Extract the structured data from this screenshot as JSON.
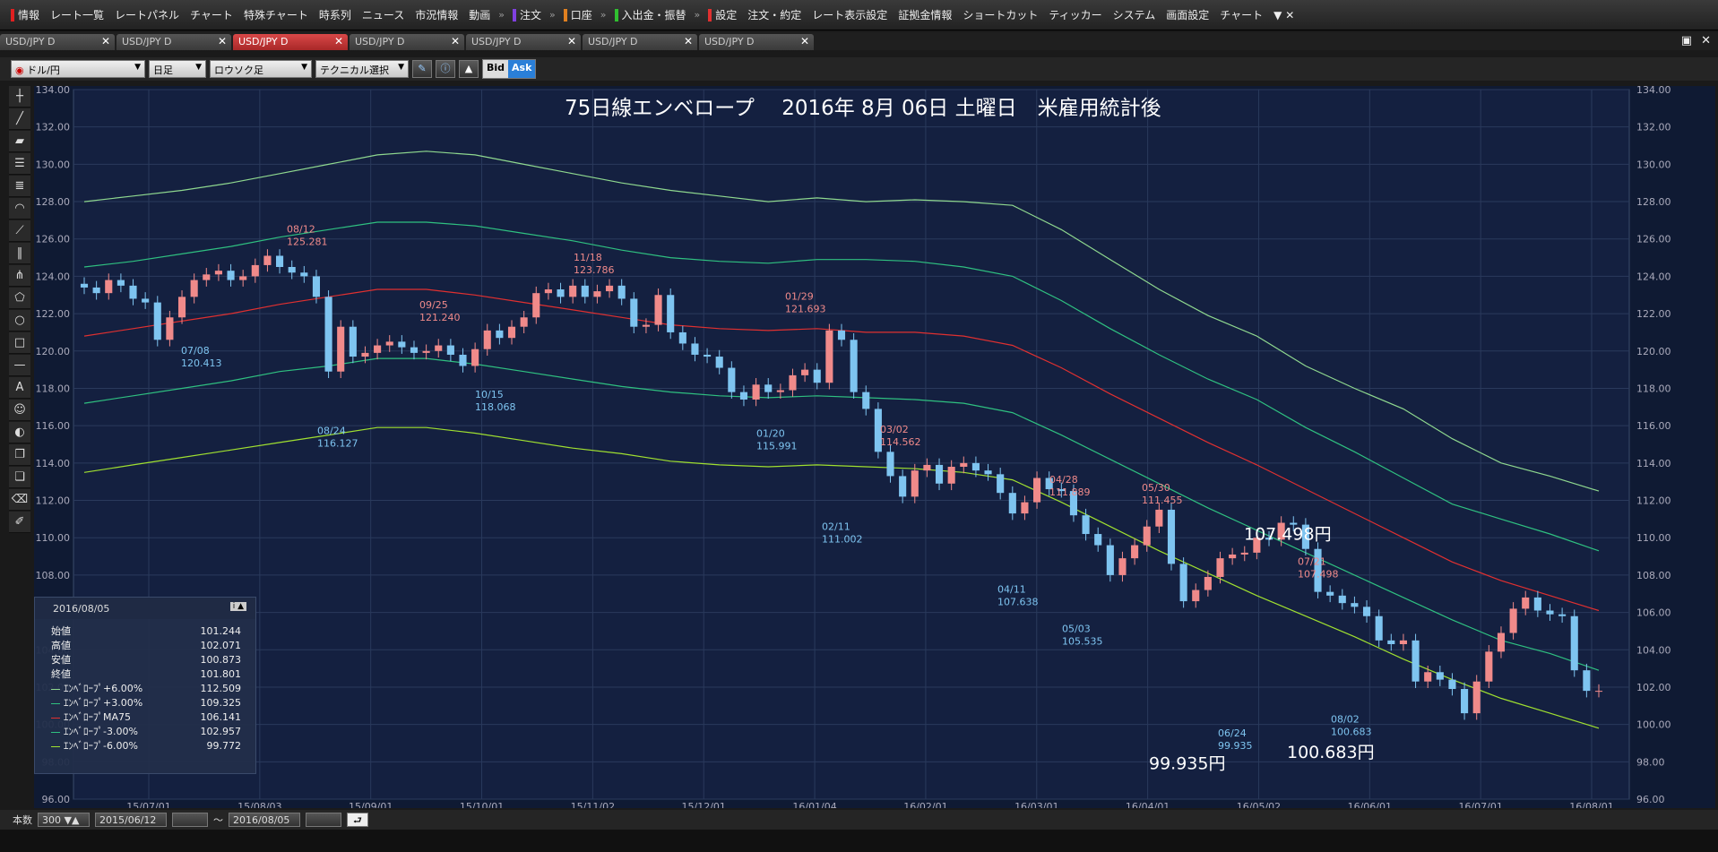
{
  "menu": {
    "items": [
      {
        "label": "情報",
        "mark": "#e02020"
      },
      {
        "label": "レート一覧"
      },
      {
        "label": "レートパネル"
      },
      {
        "label": "チャート"
      },
      {
        "label": "特殊チャート"
      },
      {
        "label": "時系列"
      },
      {
        "label": "ニュース"
      },
      {
        "label": "市況情報"
      },
      {
        "label": "動画"
      },
      {
        "label": "注文",
        "mark": "#8040e0"
      },
      {
        "label": "口座",
        "mark": "#e08020"
      },
      {
        "label": "入出金・振替",
        "mark": "#30c030"
      },
      {
        "label": "設定",
        "mark": "#e03030"
      },
      {
        "label": "注文・約定"
      },
      {
        "label": "レート表示設定"
      },
      {
        "label": "証拠金情報"
      },
      {
        "label": "ショートカット"
      },
      {
        "label": "ティッカー"
      },
      {
        "label": "システム"
      },
      {
        "label": "画面設定"
      },
      {
        "label": "チャート"
      }
    ]
  },
  "tabs": [
    {
      "label": "USD/JPY D",
      "active": false
    },
    {
      "label": "USD/JPY D",
      "active": false
    },
    {
      "label": "USD/JPY D",
      "active": true
    },
    {
      "label": "USD/JPY D",
      "active": false
    },
    {
      "label": "USD/JPY D",
      "active": false
    },
    {
      "label": "USD/JPY D",
      "active": false
    },
    {
      "label": "USD/JPY D",
      "active": false
    }
  ],
  "toolbar": {
    "pair": "ドル/円",
    "period": "日足",
    "chart_type": "ロウソク足",
    "technical": "テクニカル選択",
    "bid": "Bid",
    "ask": "Ask"
  },
  "info_box": {
    "date": "2016/08/05",
    "rows": [
      {
        "label": "始値",
        "value": "101.244"
      },
      {
        "label": "高値",
        "value": "102.071"
      },
      {
        "label": "安値",
        "value": "100.873"
      },
      {
        "label": "終値",
        "value": "101.801"
      },
      {
        "label": "ｴﾝﾍﾞﾛｰﾌﾟ+6.00%",
        "value": "112.509",
        "color": "#8fd88f"
      },
      {
        "label": "ｴﾝﾍﾞﾛｰﾌﾟ+3.00%",
        "value": "109.325",
        "color": "#2fc080"
      },
      {
        "label": "ｴﾝﾍﾞﾛｰﾌﾟMA75",
        "value": "106.141",
        "color": "#e03030"
      },
      {
        "label": "ｴﾝﾍﾞﾛｰﾌﾟ-3.00%",
        "value": "102.957",
        "color": "#2fc080"
      },
      {
        "label": "ｴﾝﾍﾞﾛｰﾌﾟ-6.00%",
        "value": "99.772",
        "color": "#a0e030"
      }
    ]
  },
  "status": {
    "count_label": "本数",
    "count": "300",
    "from": "2015/06/12",
    "tilde": "～",
    "to": "2016/08/05"
  },
  "chart_data": {
    "type": "line",
    "title": "75日線エンベロープ　 2016年 8月 06日 土曜日　米雇用統計後",
    "ylim": [
      96,
      134
    ],
    "yticks": [
      "134.00",
      "132.00",
      "130.00",
      "128.00",
      "126.00",
      "124.00",
      "122.00",
      "120.00",
      "118.00",
      "116.00",
      "114.00",
      "112.00",
      "110.00",
      "108.00",
      "106.00",
      "104.00",
      "102.00",
      "100.00",
      "98.00",
      "96.00"
    ],
    "xticks": [
      "15/07/01",
      "15/08/03",
      "15/09/01",
      "15/10/01",
      "15/11/02",
      "15/12/01",
      "16/01/04",
      "16/02/01",
      "16/03/01",
      "16/04/01",
      "16/05/02",
      "16/06/01",
      "16/07/01",
      "16/08/01"
    ],
    "close": [
      123.4,
      123.1,
      123.8,
      123.5,
      122.8,
      122.6,
      120.6,
      121.8,
      122.9,
      123.8,
      124.1,
      124.3,
      123.8,
      124.0,
      124.6,
      125.1,
      124.5,
      124.2,
      124.0,
      122.9,
      118.9,
      121.3,
      119.7,
      119.9,
      120.3,
      120.5,
      120.2,
      119.9,
      120.0,
      120.3,
      119.8,
      119.2,
      120.1,
      121.1,
      120.7,
      121.3,
      121.8,
      123.1,
      123.3,
      122.9,
      123.5,
      122.9,
      123.2,
      123.5,
      122.8,
      121.3,
      121.4,
      123.0,
      121.0,
      120.4,
      119.8,
      119.7,
      119.1,
      117.8,
      117.4,
      118.2,
      117.8,
      117.9,
      118.7,
      119.0,
      118.3,
      121.1,
      120.6,
      117.8,
      116.9,
      114.6,
      113.3,
      112.2,
      113.6,
      113.9,
      112.9,
      113.8,
      114.0,
      113.6,
      113.4,
      112.4,
      111.3,
      111.9,
      113.2,
      112.6,
      112.5,
      111.2,
      110.2,
      109.6,
      108.0,
      108.9,
      109.6,
      110.6,
      111.5,
      108.6,
      106.6,
      107.2,
      107.9,
      108.9,
      109.1,
      109.2,
      110.0,
      109.9,
      110.8,
      110.7,
      109.4,
      107.1,
      106.9,
      106.5,
      106.3,
      105.8,
      104.5,
      104.3,
      104.5,
      102.3,
      102.8,
      102.4,
      101.9,
      100.6,
      102.3,
      103.9,
      104.9,
      106.2,
      106.8,
      106.1,
      105.9,
      105.8,
      102.9,
      101.8,
      101.8
    ],
    "annotations": [
      {
        "x": "07/08",
        "y": 120.413,
        "kind": "low",
        "text1": "07/08",
        "text2": "120.413"
      },
      {
        "x": "08/12",
        "y": 125.281,
        "kind": "high",
        "text1": "08/12",
        "text2": "125.281"
      },
      {
        "x": "08/24",
        "y": 116.127,
        "kind": "low",
        "text1": "08/24",
        "text2": "116.127"
      },
      {
        "x": "09/25",
        "y": 121.24,
        "kind": "high",
        "text1": "09/25",
        "text2": "121.240"
      },
      {
        "x": "10/15",
        "y": 118.068,
        "kind": "low",
        "text1": "10/15",
        "text2": "118.068"
      },
      {
        "x": "11/18",
        "y": 123.786,
        "kind": "high",
        "text1": "11/18",
        "text2": "123.786"
      },
      {
        "x": "01/20",
        "y": 115.991,
        "kind": "low",
        "text1": "01/20",
        "text2": "115.991"
      },
      {
        "x": "01/29",
        "y": 121.693,
        "kind": "high",
        "text1": "01/29",
        "text2": "121.693"
      },
      {
        "x": "02/11",
        "y": 111.002,
        "kind": "low",
        "text1": "02/11",
        "text2": "111.002"
      },
      {
        "x": "03/02",
        "y": 114.562,
        "kind": "high",
        "text1": "03/02",
        "text2": "114.562"
      },
      {
        "x": "04/11",
        "y": 107.638,
        "kind": "low",
        "text1": "04/11",
        "text2": "107.638"
      },
      {
        "x": "04/28",
        "y": 111.889,
        "kind": "high",
        "text1": "04/28",
        "text2": "111.889"
      },
      {
        "x": "05/03",
        "y": 105.535,
        "kind": "low",
        "text1": "05/03",
        "text2": "105.535"
      },
      {
        "x": "05/30",
        "y": 111.455,
        "kind": "high",
        "text1": "05/30",
        "text2": "111.455"
      },
      {
        "x": "06/24",
        "y": 99.935,
        "kind": "low",
        "text1": "06/24",
        "text2": "99.935"
      },
      {
        "x": "07/21",
        "y": 107.498,
        "kind": "high",
        "text1": "07/21",
        "text2": "107.498"
      },
      {
        "x": "08/02",
        "y": 100.683,
        "kind": "low",
        "text1": "08/02",
        "text2": "100.683"
      }
    ],
    "big_labels": [
      {
        "text": "107.498円",
        "y": 109.9,
        "near": "07/21"
      },
      {
        "text": "99.935円",
        "y": 97.6,
        "near": "06/24"
      },
      {
        "text": "100.683円",
        "y": 98.2,
        "near": "08/02"
      }
    ],
    "series": [
      {
        "name": "ｴﾝﾍﾞﾛｰﾌﾟ+6.00%",
        "color": "#8fd88f",
        "values": [
          128.0,
          128.3,
          128.6,
          129.0,
          129.5,
          130.0,
          130.5,
          130.7,
          130.5,
          130.0,
          129.5,
          129.0,
          128.6,
          128.3,
          128.0,
          128.2,
          128.0,
          128.1,
          128.0,
          127.8,
          126.5,
          124.9,
          123.3,
          121.9,
          120.8,
          119.2,
          118.0,
          116.9,
          115.3,
          114.0,
          113.3,
          112.5
        ]
      },
      {
        "name": "ｴﾝﾍﾞﾛｰﾌﾟ+3.00%",
        "color": "#2fc080",
        "values": [
          124.5,
          124.8,
          125.2,
          125.6,
          126.1,
          126.5,
          126.9,
          126.9,
          126.7,
          126.3,
          125.9,
          125.4,
          125.0,
          124.8,
          124.7,
          124.9,
          124.9,
          124.8,
          124.5,
          124.0,
          122.7,
          121.2,
          119.8,
          118.5,
          117.4,
          115.9,
          114.6,
          113.2,
          111.8,
          111.0,
          110.2,
          109.3
        ]
      },
      {
        "name": "ｴﾝﾍﾞﾛｰﾌﾟMA75",
        "color": "#e03030",
        "values": [
          120.8,
          121.2,
          121.6,
          122.0,
          122.5,
          122.9,
          123.3,
          123.3,
          123.0,
          122.6,
          122.2,
          121.8,
          121.4,
          121.2,
          121.1,
          121.2,
          121.0,
          121.0,
          120.8,
          120.3,
          119.1,
          117.7,
          116.4,
          115.1,
          113.9,
          112.6,
          111.3,
          110.0,
          108.7,
          107.7,
          106.9,
          106.1
        ]
      },
      {
        "name": "ｴﾝﾍﾞﾛｰﾌﾟ-3.00%",
        "color": "#2fc080",
        "values": [
          117.2,
          117.6,
          118.0,
          118.4,
          118.9,
          119.2,
          119.6,
          119.6,
          119.3,
          118.9,
          118.5,
          118.1,
          117.8,
          117.6,
          117.5,
          117.6,
          117.5,
          117.4,
          117.2,
          116.7,
          115.5,
          114.2,
          112.9,
          111.6,
          110.4,
          109.2,
          108.0,
          106.8,
          105.6,
          104.5,
          103.8,
          102.9
        ]
      },
      {
        "name": "ｴﾝﾍﾞﾛｰﾌﾟ-6.00%",
        "color": "#a0e030",
        "values": [
          113.5,
          113.9,
          114.3,
          114.7,
          115.1,
          115.5,
          115.9,
          115.9,
          115.6,
          115.2,
          114.8,
          114.5,
          114.1,
          113.9,
          113.8,
          113.9,
          113.8,
          113.7,
          113.5,
          113.1,
          111.9,
          110.6,
          109.3,
          108.1,
          106.9,
          105.8,
          104.7,
          103.5,
          102.4,
          101.4,
          100.6,
          99.8
        ]
      }
    ]
  }
}
